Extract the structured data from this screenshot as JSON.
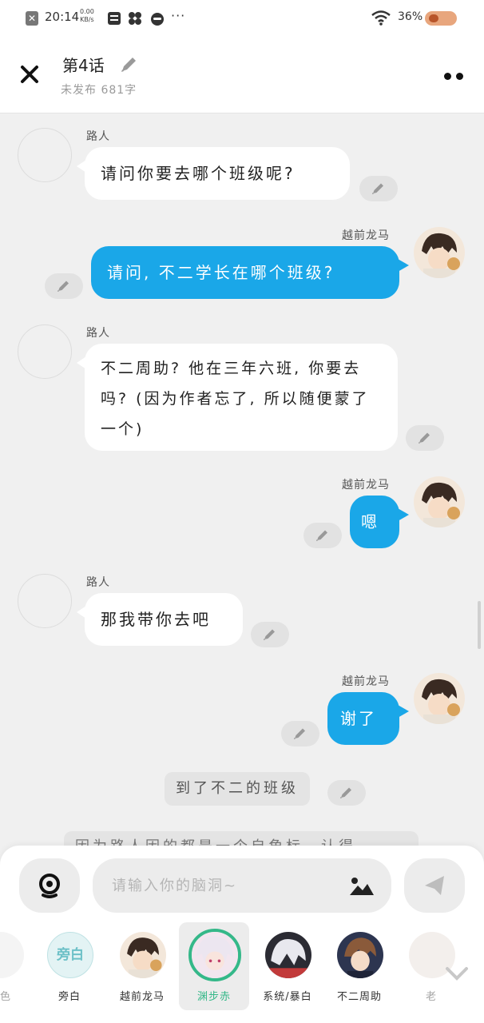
{
  "status_bar": {
    "time": "20:14",
    "net_speed": "0.00",
    "net_unit": "KB/s",
    "more": "···",
    "battery": "36%"
  },
  "header": {
    "title": "第4话",
    "subtitle": "未发布 681字"
  },
  "messages": [
    {
      "side": "left",
      "sender": "路人",
      "text": "请问你要去哪个班级呢?"
    },
    {
      "side": "right",
      "sender": "越前龙马",
      "text": "请问, 不二学长在哪个班级?"
    },
    {
      "side": "left",
      "sender": "路人",
      "text": "不二周助? 他在三年六班, 你要去吗? (因为作者忘了, 所以随便蒙了一个)"
    },
    {
      "side": "right",
      "sender": "越前龙马",
      "text": "嗯"
    },
    {
      "side": "left",
      "sender": "路人",
      "text": "那我带你去吧"
    },
    {
      "side": "right",
      "sender": "越前龙马",
      "text": "谢了"
    },
    {
      "side": "center",
      "text": "到了不二的班级"
    },
    {
      "side": "center",
      "text": "因为路人因的都是一个自角标，认得"
    }
  ],
  "input": {
    "placeholder": "请输入你的脑洞~"
  },
  "roles": [
    {
      "name": "角色"
    },
    {
      "name": "旁白",
      "badge": "旁白"
    },
    {
      "name": "越前龙马"
    },
    {
      "name": "渊步赤"
    },
    {
      "name": "系统/暴白"
    },
    {
      "name": "不二周助"
    },
    {
      "name": "老"
    }
  ],
  "colors": {
    "accent_bubble": "#1aa7e8",
    "active_role": "#35b889",
    "background": "#f0f0f0"
  },
  "icons": [
    "close-icon",
    "pencil-icon",
    "more-dots-icon",
    "voice-icon",
    "image-icon",
    "send-icon",
    "chevron-down-icon"
  ]
}
